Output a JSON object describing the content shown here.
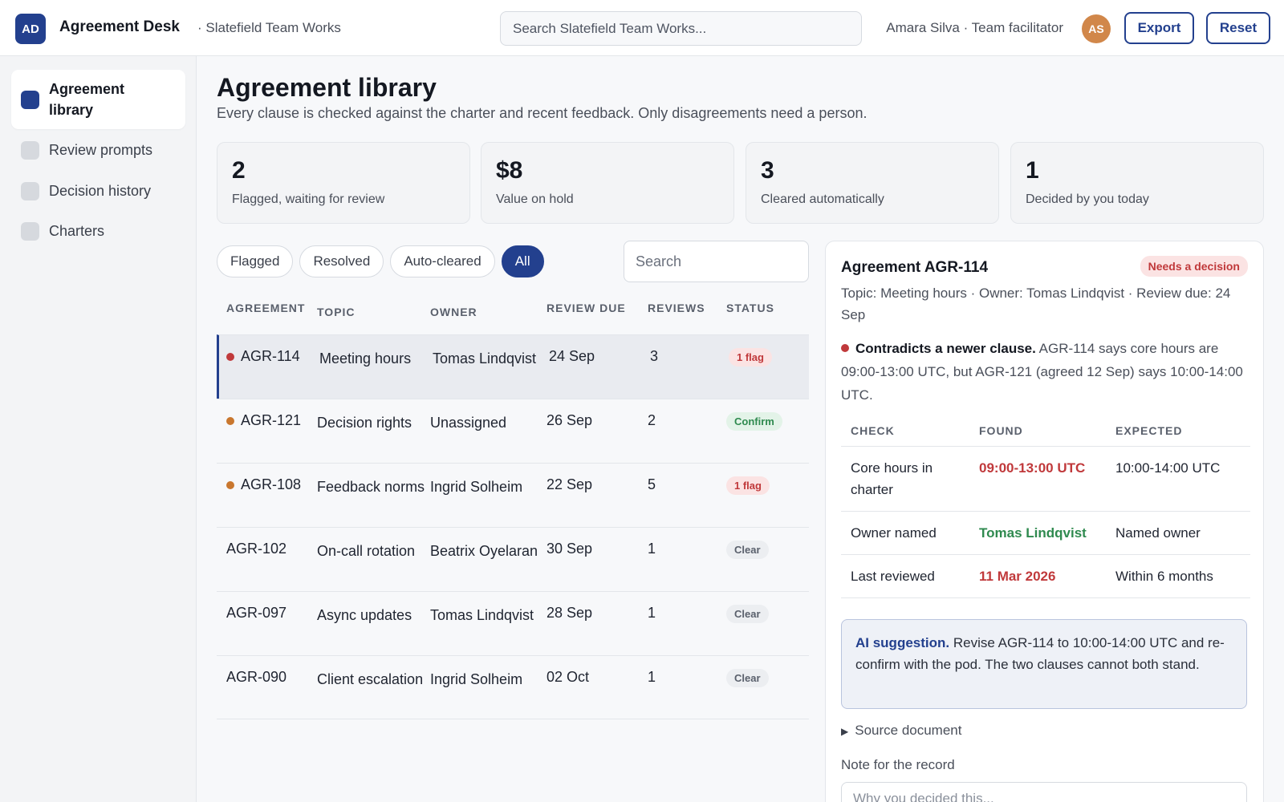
{
  "header": {
    "logo": "AD",
    "app_title": "Agreement Desk",
    "workspace": "· Slatefield Team Works",
    "search_placeholder": "Search Slatefield Team Works...",
    "user_label": "Amara Silva · Team facilitator",
    "avatar": "AS",
    "export_label": "Export",
    "reset_label": "Reset"
  },
  "sidebar": {
    "items": [
      {
        "label": "Agreement library",
        "active": true
      },
      {
        "label": "Review prompts",
        "active": false
      },
      {
        "label": "Decision history",
        "active": false
      },
      {
        "label": "Charters",
        "active": false
      }
    ]
  },
  "page": {
    "title": "Agreement library",
    "subtitle": "Every clause is checked against the charter and recent feedback. Only disagreements need a person."
  },
  "stats": [
    {
      "value": "2",
      "caption": "Flagged, waiting for review"
    },
    {
      "value": "$8",
      "caption": "Value on hold"
    },
    {
      "value": "3",
      "caption": "Cleared automatically"
    },
    {
      "value": "1",
      "caption": "Decided by you today"
    }
  ],
  "filters": [
    "Flagged",
    "Resolved",
    "Auto-cleared",
    "All"
  ],
  "active_filter": "All",
  "list_search_placeholder": "Search",
  "table": {
    "headers": [
      "AGREEMENT",
      "TOPIC",
      "OWNER",
      "REVIEW DUE",
      "REVIEWS",
      "STATUS"
    ],
    "rows": [
      {
        "id": "AGR-114",
        "topic": "Meeting hours",
        "owner": "Tomas Lindqvist",
        "due": "24 Sep",
        "reviews": "3",
        "status": "1 flag",
        "kind": "flag",
        "dot": "#c0393b"
      },
      {
        "id": "AGR-121",
        "topic": "Decision rights",
        "owner": "Unassigned",
        "due": "26 Sep",
        "reviews": "2",
        "status": "Confirm",
        "kind": "confirm",
        "dot": "#c9772e"
      },
      {
        "id": "AGR-108",
        "topic": "Feedback norms",
        "owner": "Ingrid Solheim",
        "due": "22 Sep",
        "reviews": "5",
        "status": "1 flag",
        "kind": "flag",
        "dot": "#c9772e"
      },
      {
        "id": "AGR-102",
        "topic": "On-call rotation",
        "owner": "Beatrix Oyelaran",
        "due": "30 Sep",
        "reviews": "1",
        "status": "Clear",
        "kind": "clear",
        "dot": ""
      },
      {
        "id": "AGR-097",
        "topic": "Async updates",
        "owner": "Tomas Lindqvist",
        "due": "28 Sep",
        "reviews": "1",
        "status": "Clear",
        "kind": "clear",
        "dot": ""
      },
      {
        "id": "AGR-090",
        "topic": "Client escalation",
        "owner": "Ingrid Solheim",
        "due": "02 Oct",
        "reviews": "1",
        "status": "Clear",
        "kind": "clear",
        "dot": ""
      }
    ]
  },
  "detail": {
    "title": "Agreement AGR-114",
    "badge": "Needs a decision",
    "meta": "Topic: Meeting hours · Owner: Tomas Lindqvist · Review due: 24 Sep",
    "issue_head": "Contradicts a newer clause.",
    "issue_body": "AGR-114 says core hours are 09:00-13:00 UTC, but AGR-121 (agreed 12 Sep) says 10:00-14:00 UTC.",
    "check_headers": [
      "CHECK",
      "FOUND",
      "EXPECTED"
    ],
    "checks": [
      {
        "check": "Core hours in charter",
        "found": "09:00-13:00 UTC",
        "expected": "10:00-14:00 UTC",
        "ok": false
      },
      {
        "check": "Owner named",
        "found": "Tomas Lindqvist",
        "expected": "Named owner",
        "ok": true
      },
      {
        "check": "Last reviewed",
        "found": "11 Mar 2026",
        "expected": "Within 6 months",
        "ok": false
      }
    ],
    "ai_head": "AI suggestion.",
    "ai_body": "Revise AGR-114 to 10:00-14:00 UTC and re-confirm with the pod. The two clauses cannot both stand.",
    "source_label": "Source document",
    "note_label": "Note for the record",
    "note_placeholder": "Why you decided this..."
  },
  "colors": {
    "accent": "#23408e",
    "danger": "#c0393b",
    "success": "#2f8a4f",
    "warning": "#c9772e"
  }
}
